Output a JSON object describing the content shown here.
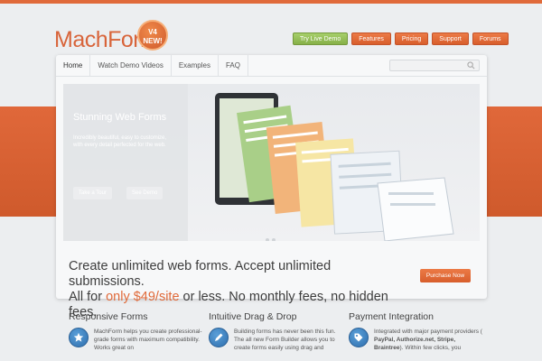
{
  "brand": {
    "name": "MachForm",
    "badge_line1": "V4",
    "badge_line2": "NEW!"
  },
  "topnav": [
    {
      "label": "Try Live Demo"
    },
    {
      "label": "Features"
    },
    {
      "label": "Pricing"
    },
    {
      "label": "Support"
    },
    {
      "label": "Forums"
    }
  ],
  "subnav": [
    {
      "label": "Home"
    },
    {
      "label": "Watch Demo Videos"
    },
    {
      "label": "Examples"
    },
    {
      "label": "FAQ"
    }
  ],
  "search": {
    "placeholder": ""
  },
  "slider": {
    "title": "Stunning Web Forms",
    "text": "Incredibly beautiful, easy to customize, with every detail perfected for the web.",
    "button1": "Take a Tour",
    "button2": "See Demo"
  },
  "headline": {
    "line1": "Create unlimited web forms. Accept unlimited submissions.",
    "line2_prefix": "All for ",
    "line2_price": "only $49/site",
    "line2_suffix": " or less. No monthly fees, no hidden fees.",
    "button": "Purchase Now"
  },
  "features": [
    {
      "title": "Responsive Forms",
      "text": "MachForm helps you create professional-grade forms with maximum compatibility. Works great on"
    },
    {
      "title": "Intuitive Drag & Drop",
      "text": "Building forms has never been this fun. The all new Form Builder allows you to create forms easily using drag and"
    },
    {
      "title": "Payment Integration",
      "text_prefix": "Integrated with major payment providers ( ",
      "text_bold": "PayPal, Authorize.net, Stripe, Braintree",
      "text_suffix": "). Within few clicks, you"
    }
  ],
  "colors": {
    "accent": "#e06a3a",
    "demo_green": "#96c058",
    "icon_blue": "#3a7dc0"
  }
}
